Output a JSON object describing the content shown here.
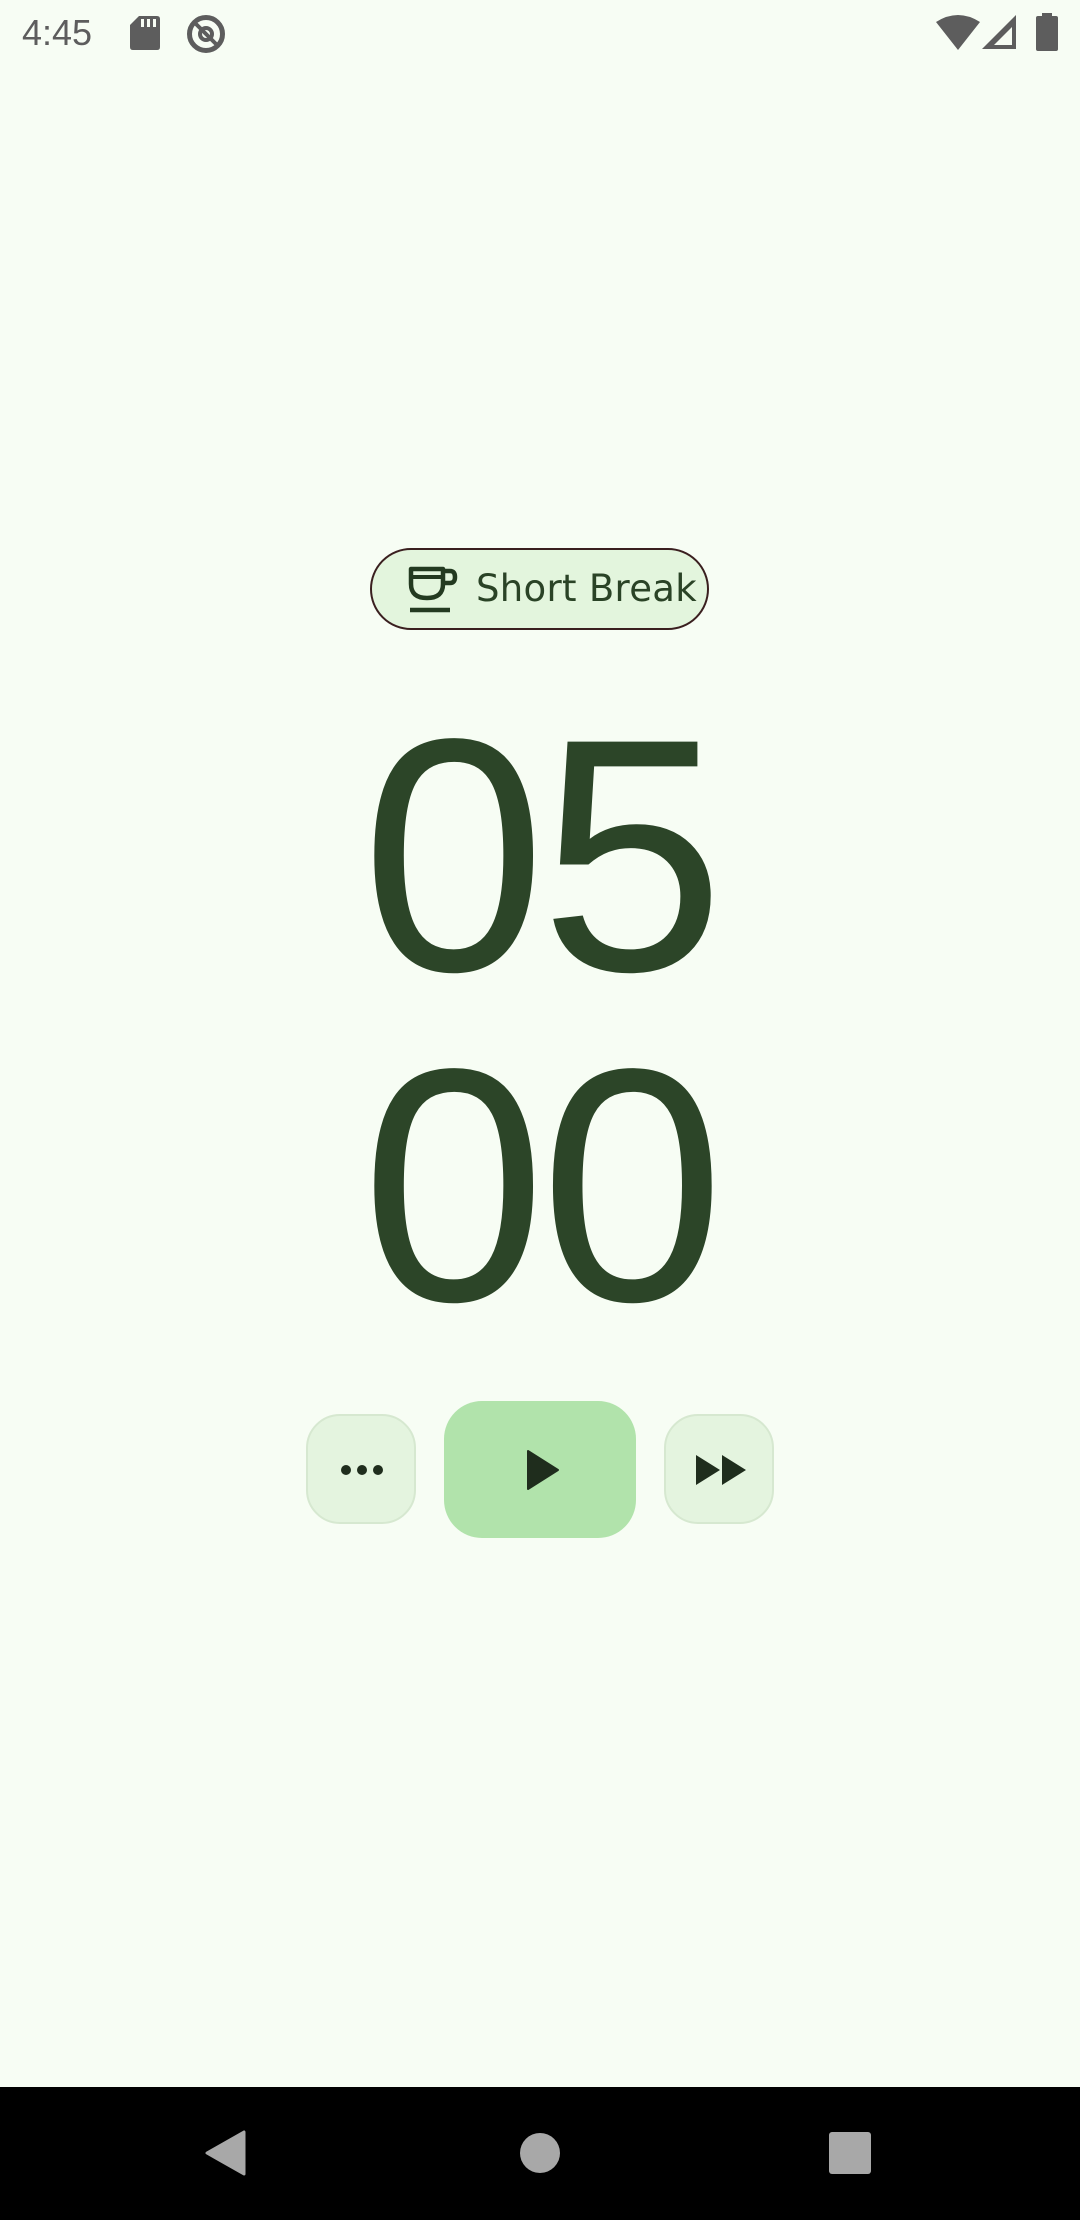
{
  "status_bar": {
    "time": "4:45",
    "icons": [
      "sd-card-icon",
      "at-sign-icon",
      "wifi-icon",
      "cellular-signal-icon",
      "battery-icon"
    ]
  },
  "mode_chip": {
    "label": "Short Break",
    "icon": "coffee-cup-icon"
  },
  "timer": {
    "minutes": "05",
    "seconds": "00"
  },
  "controls": {
    "more": "more-options-icon",
    "play": "play-icon",
    "skip": "skip-forward-icon"
  },
  "nav_bar": {
    "buttons": [
      "back-icon",
      "home-icon",
      "recents-icon"
    ]
  },
  "colors": {
    "background": "#f7fdf4",
    "timer_text": "#2c4528",
    "chip_background": "#e3f5dd",
    "chip_border": "#3a1f1f",
    "play_button": "#b1e3ab",
    "secondary_button": "#e4f4df"
  }
}
